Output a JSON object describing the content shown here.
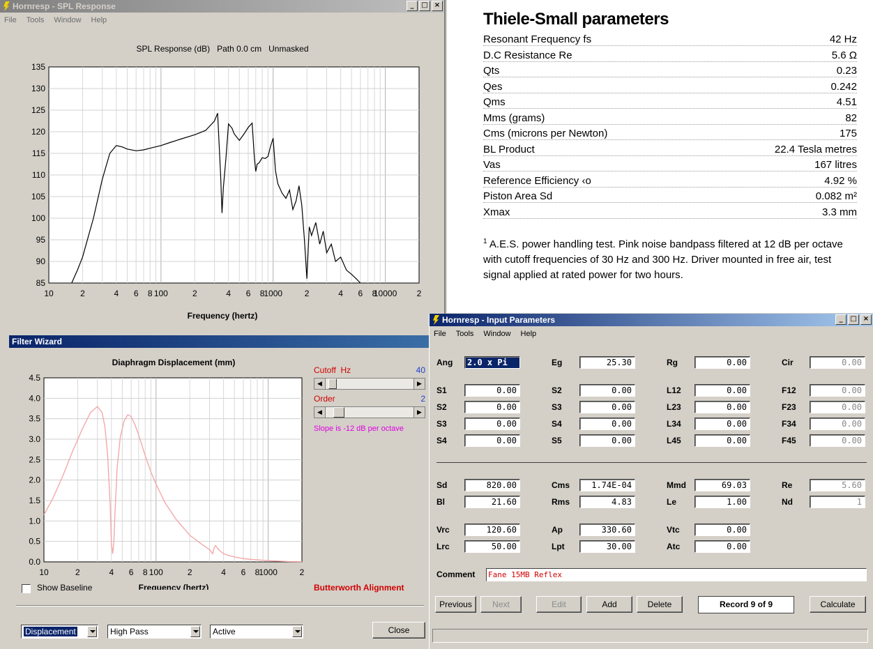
{
  "spl_window": {
    "title": "Hornresp - SPL Response",
    "menu": [
      "File",
      "Tools",
      "Window",
      "Help"
    ],
    "chart_title": "SPL Response (dB)   Path 0.0 cm   Unmasked",
    "xlabel": "Frequency (hertz)"
  },
  "ts_panel": {
    "title": "Thiele-Small parameters",
    "rows": [
      {
        "label": "Resonant Frequency fs",
        "value": "42 Hz"
      },
      {
        "label": "D.C Resistance Re",
        "value": "5.6 Ω"
      },
      {
        "label": "Qts",
        "value": "0.23"
      },
      {
        "label": "Qes",
        "value": "0.242"
      },
      {
        "label": "Qms",
        "value": "4.51"
      },
      {
        "label": "Mms (grams)",
        "value": "82"
      },
      {
        "label": "Cms (microns per Newton)",
        "value": "175"
      },
      {
        "label": "BL Product",
        "value": "22.4 Tesla metres"
      },
      {
        "label": "Vas",
        "value": "167 litres"
      },
      {
        "label": "Reference Efficiency ‹o",
        "value": "4.92 %"
      },
      {
        "label": "Piston Area Sd",
        "value": "0.082 m²"
      },
      {
        "label": "Xmax",
        "value": "3.3 mm"
      }
    ],
    "footnote_mark": "1",
    "footnote": "A.E.S. power handling test. Pink noise bandpass filtered at 12 dB per octave with cutoff frequencies of 30 Hz and 300 Hz. Driver mounted in free air, test signal applied at rated power for two hours."
  },
  "filter_window": {
    "title": "Filter Wizard",
    "chart_title": "Diaphragm Displacement (mm)",
    "xlabel": "Frequency (hertz)",
    "cutoff_label": "Cutoff  Hz",
    "cutoff_value": "40",
    "order_label": "Order",
    "order_value": "2",
    "slope_text": "Slope is -12 dB per octave",
    "show_baseline": "Show Baseline",
    "alignment": "Butterworth Alignment",
    "dropdowns": [
      "Displacement",
      "High Pass",
      "Active"
    ],
    "close": "Close",
    "cutoff_fraction": 0.04,
    "order_fraction": 0.1
  },
  "input_window": {
    "title": "Hornresp - Input Parameters",
    "menu": [
      "File",
      "Tools",
      "Window",
      "Help"
    ],
    "rows1": [
      [
        {
          "l": "Ang",
          "v": "2.0 x Pi"
        },
        {
          "l": "Eg",
          "v": "25.30"
        },
        {
          "l": "Rg",
          "v": "0.00"
        },
        {
          "l": "Cir",
          "v": "0.00"
        }
      ]
    ],
    "rows2": [
      [
        {
          "l": "S1",
          "v": "0.00"
        },
        {
          "l": "S2",
          "v": "0.00"
        },
        {
          "l": "L12",
          "v": "0.00"
        },
        {
          "l": "F12",
          "v": "0.00"
        }
      ],
      [
        {
          "l": "S2",
          "v": "0.00"
        },
        {
          "l": "S3",
          "v": "0.00"
        },
        {
          "l": "L23",
          "v": "0.00"
        },
        {
          "l": "F23",
          "v": "0.00"
        }
      ],
      [
        {
          "l": "S3",
          "v": "0.00"
        },
        {
          "l": "S4",
          "v": "0.00"
        },
        {
          "l": "L34",
          "v": "0.00"
        },
        {
          "l": "F34",
          "v": "0.00"
        }
      ],
      [
        {
          "l": "S4",
          "v": "0.00"
        },
        {
          "l": "S5",
          "v": "0.00"
        },
        {
          "l": "L45",
          "v": "0.00"
        },
        {
          "l": "F45",
          "v": "0.00"
        }
      ]
    ],
    "rows3": [
      [
        {
          "l": "Sd",
          "v": "820.00"
        },
        {
          "l": "Cms",
          "v": "1.74E-04"
        },
        {
          "l": "Mmd",
          "v": "69.03"
        },
        {
          "l": "Re",
          "v": "5.60"
        }
      ],
      [
        {
          "l": "Bl",
          "v": "21.60"
        },
        {
          "l": "Rms",
          "v": "4.83"
        },
        {
          "l": "Le",
          "v": "1.00"
        },
        {
          "l": "Nd",
          "v": "1"
        }
      ]
    ],
    "rows4": [
      [
        {
          "l": "Vrc",
          "v": "120.60"
        },
        {
          "l": "Ap",
          "v": "330.60"
        },
        {
          "l": "Vtc",
          "v": "0.00"
        }
      ],
      [
        {
          "l": "Lrc",
          "v": "50.00"
        },
        {
          "l": "Lpt",
          "v": "30.00"
        },
        {
          "l": "Atc",
          "v": "0.00"
        }
      ]
    ],
    "comment_label": "Comment",
    "comment": "Fane 15MB Reflex",
    "buttons": [
      "Previous",
      "Next",
      "Edit",
      "Add",
      "Delete",
      "Calculate"
    ],
    "record": "Record 9 of 9"
  },
  "chart_data": [
    {
      "type": "line",
      "title": "SPL Response (dB)   Path 0.0 cm   Unmasked",
      "xlabel": "Frequency (hertz)",
      "ylabel": "",
      "xscale": "log",
      "xlim": [
        10,
        20000
      ],
      "ylim": [
        85,
        135
      ],
      "yticks": [
        85,
        90,
        95,
        100,
        105,
        110,
        115,
        120,
        125,
        130,
        135
      ],
      "xticklabels": [
        "10",
        "2",
        "4",
        "6",
        "8",
        "100",
        "2",
        "4",
        "6",
        "8",
        "1000",
        "2",
        "4",
        "6",
        "8",
        "10000",
        "2"
      ],
      "grid": true,
      "color": "#000000",
      "x": [
        16,
        18,
        20,
        25,
        30,
        35,
        40,
        45,
        50,
        60,
        70,
        80,
        100,
        120,
        150,
        200,
        250,
        300,
        320,
        340,
        350,
        360,
        380,
        400,
        430,
        450,
        500,
        550,
        600,
        650,
        680,
        700,
        720,
        750,
        800,
        850,
        900,
        950,
        1000,
        1050,
        1100,
        1200,
        1300,
        1400,
        1500,
        1600,
        1700,
        1800,
        1900,
        2000,
        2100,
        2200,
        2400,
        2600,
        2800,
        3000,
        3300,
        3600,
        4000,
        4500,
        5000,
        5500,
        6000
      ],
      "y": [
        85,
        88,
        91,
        100,
        109,
        115,
        116.8,
        116.5,
        116,
        115.6,
        115.8,
        116.2,
        116.8,
        117.5,
        118.3,
        119.3,
        120.3,
        122.5,
        124.3,
        110,
        101.2,
        107,
        114,
        121.8,
        120.8,
        119.5,
        118,
        119.5,
        121,
        122,
        114,
        110.8,
        112.5,
        112.8,
        114,
        113.8,
        114.3,
        116.7,
        118.5,
        111,
        108,
        105.8,
        104.6,
        106.5,
        102,
        104,
        107.5,
        103,
        95,
        86,
        98,
        96,
        99,
        94,
        97,
        92,
        94,
        90,
        91,
        88,
        87,
        86,
        85
      ]
    },
    {
      "type": "line",
      "title": "Diaphragm Displacement (mm)",
      "xlabel": "Frequency (hertz)",
      "ylabel": "",
      "xscale": "log",
      "xlim": [
        10,
        2000
      ],
      "ylim": [
        0,
        4.5
      ],
      "yticks": [
        0.0,
        0.5,
        1.0,
        1.5,
        2.0,
        2.5,
        3.0,
        3.5,
        4.0,
        4.5
      ],
      "xticklabels": [
        "10",
        "2",
        "4",
        "6",
        "8",
        "100",
        "2",
        "4",
        "6",
        "8",
        "1000",
        "2"
      ],
      "grid": true,
      "color": "#f4a8a8",
      "x": [
        10,
        12,
        15,
        18,
        22,
        26,
        30,
        33,
        35,
        37,
        39,
        40,
        41,
        42,
        43,
        45,
        48,
        52,
        56,
        60,
        65,
        70,
        80,
        90,
        100,
        120,
        150,
        200,
        250,
        300,
        320,
        330,
        340,
        360,
        400,
        450,
        500,
        600,
        700,
        800,
        1000,
        1200,
        1500,
        2000
      ],
      "y": [
        1.15,
        1.55,
        2.15,
        2.7,
        3.25,
        3.65,
        3.8,
        3.65,
        3.3,
        2.6,
        1.4,
        0.45,
        0.2,
        0.45,
        1.2,
        2.3,
        3.05,
        3.45,
        3.6,
        3.55,
        3.35,
        3.1,
        2.6,
        2.2,
        1.9,
        1.45,
        1.05,
        0.65,
        0.45,
        0.3,
        0.2,
        0.35,
        0.4,
        0.3,
        0.2,
        0.15,
        0.12,
        0.08,
        0.06,
        0.05,
        0.03,
        0.02,
        0.01,
        0.005
      ]
    }
  ]
}
